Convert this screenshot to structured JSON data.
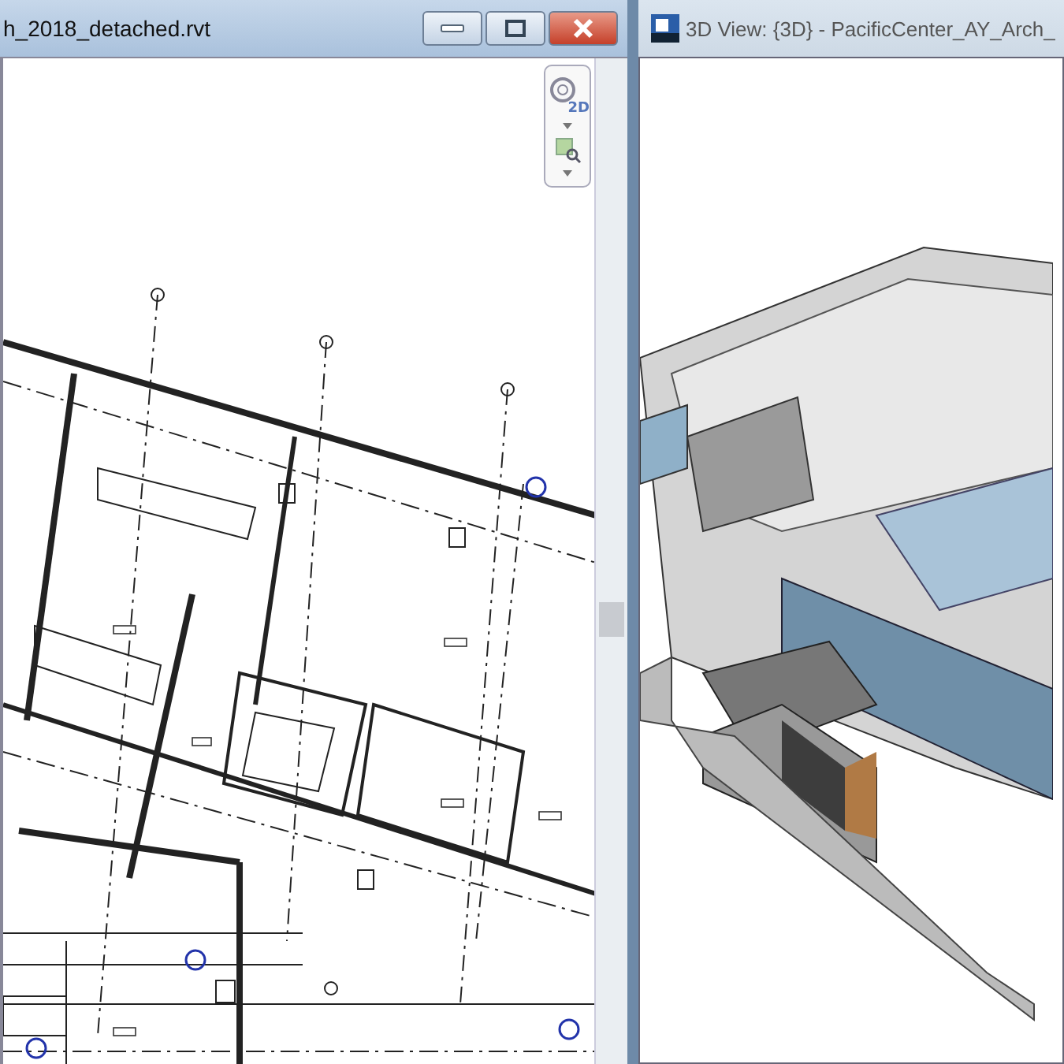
{
  "left_window": {
    "title": "h_2018_detached.rvt",
    "nav_bar": {
      "wheel_label": "2D"
    }
  },
  "right_window": {
    "title": "3D View: {3D} - PacificCenter_AY_Arch_"
  }
}
